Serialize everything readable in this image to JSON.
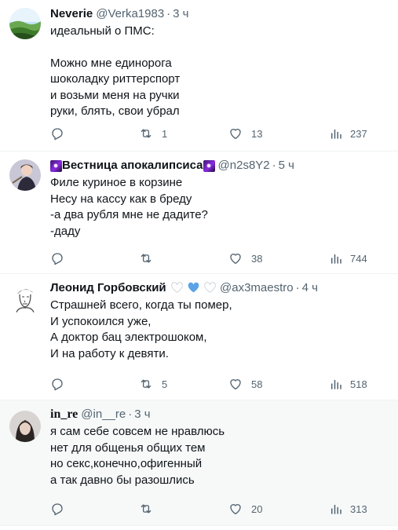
{
  "colors": {
    "text": "#0f1419",
    "secondary": "#536471",
    "divider": "#eff3f4",
    "highlight_bg": "#f7f9f9",
    "blue_heart": "#5ba3e6"
  },
  "tweets": [
    {
      "name": "Neverie",
      "handle": "@Verka1983",
      "dot": "·",
      "time": "3 ч",
      "lines": [
        "идеальный о ПМС:",
        "",
        "Можно мне единорога",
        "шоколадку риттерспорт",
        "и возьми меня на ручки",
        "руки, блять, свои убрал"
      ],
      "replies": "",
      "retweets": "1",
      "likes": "13",
      "views": "237"
    },
    {
      "name": "Вестница апокалипсиса",
      "handle": "@n2s8Y2",
      "dot": "·",
      "time": "5 ч",
      "lines": [
        "Филе куриное в корзине",
        "Несу на кассу как в бреду",
        "-а два рубля мне не дадите?",
        "-даду"
      ],
      "replies": "",
      "retweets": "",
      "likes": "38",
      "views": "744"
    },
    {
      "name": "Леонид Горбовский",
      "handle": "@ax3maestro",
      "dot": "·",
      "time": "4 ч",
      "lines": [
        "Страшней всего, когда ты помер,",
        "И успокоился уже,",
        "А доктор бац электрошоком,",
        "И на работу к девяти."
      ],
      "replies": "",
      "retweets": "5",
      "likes": "58",
      "views": "518"
    },
    {
      "name": "in_re",
      "handle": "@in__re",
      "dot": "·",
      "time": "3 ч",
      "lines": [
        "я сам себе совсем не нравлюсь",
        "нет для общенья общих тем",
        "но секс,конечно,офигенный",
        "а так давно бы разошлись"
      ],
      "replies": "",
      "retweets": "",
      "likes": "20",
      "views": "313"
    }
  ]
}
